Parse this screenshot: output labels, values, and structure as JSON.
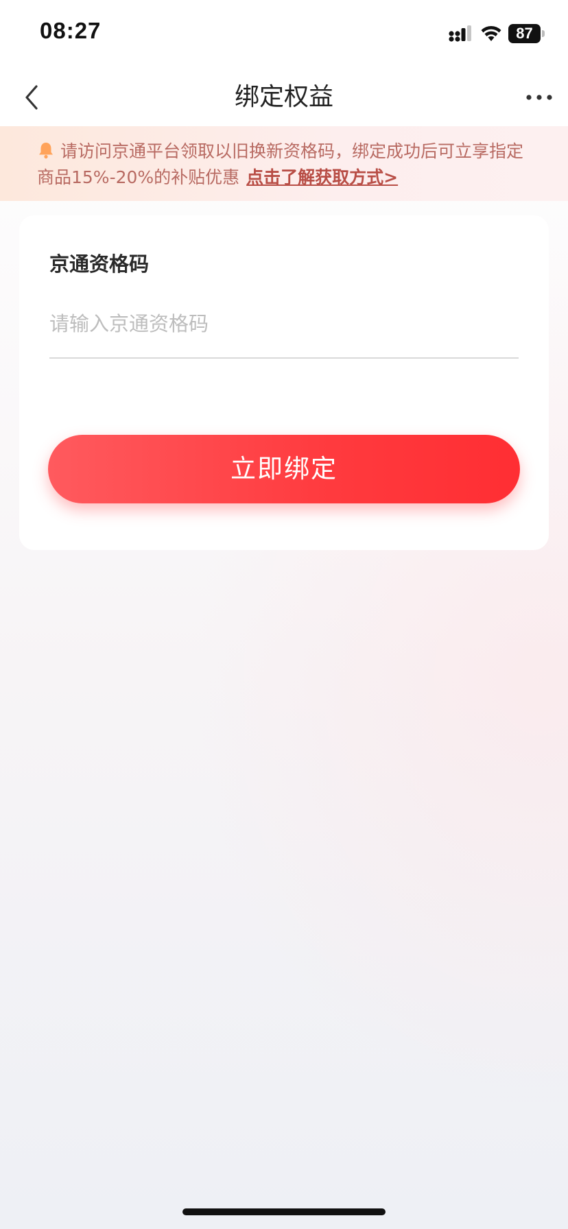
{
  "status_bar": {
    "time": "08:27",
    "battery": "87"
  },
  "nav": {
    "title": "绑定权益"
  },
  "notice": {
    "text": "请访问京通平台领取以旧换新资格码，绑定成功后可立享指定商品15%-20%的补贴优惠",
    "link": "点击了解获取方式>"
  },
  "form": {
    "label": "京通资格码",
    "input_value": "",
    "input_placeholder": "请输入京通资格码",
    "submit_label": "立即绑定"
  },
  "colors": {
    "accent": "#ff3a3e",
    "notice_text": "#b86a62"
  },
  "icons": {
    "back": "chevron-left-icon",
    "more": "more-dots-icon",
    "notice": "bell-icon"
  }
}
